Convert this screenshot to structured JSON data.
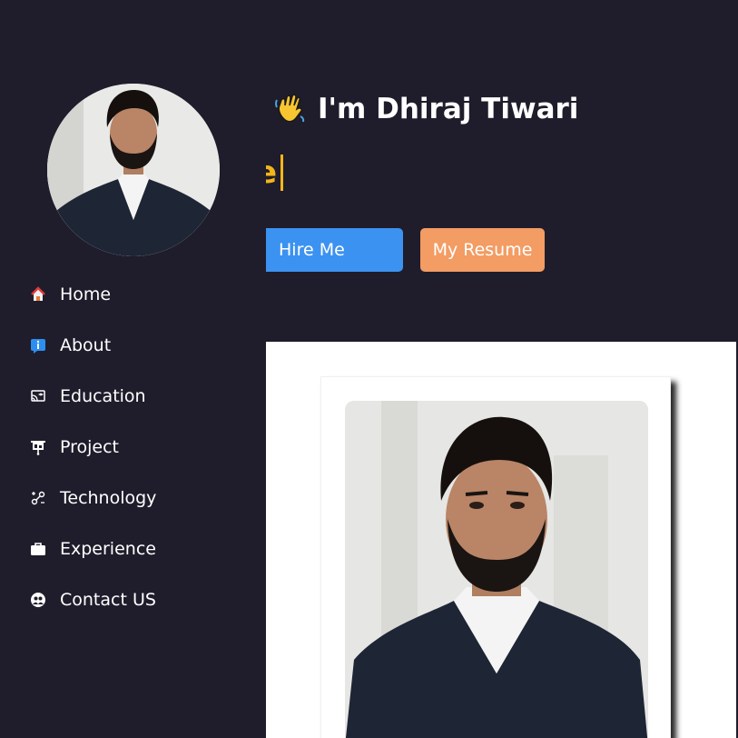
{
  "header": {
    "toggle_icon": "double-chevron-right-icon",
    "greeting": "I'm Dhiraj Tiwari",
    "wave_icon": "waving-hand-emoji",
    "typed_text": "e"
  },
  "buttons": {
    "hire_label": "Hire Me",
    "resume_label": "My Resume"
  },
  "sidebar": {
    "avatar_icon": "profile-photo",
    "items": [
      {
        "label": "Home",
        "icon": "house-icon"
      },
      {
        "label": "About",
        "icon": "info-icon"
      },
      {
        "label": "Education",
        "icon": "cast-education-icon"
      },
      {
        "label": "Project",
        "icon": "presentation-icon"
      },
      {
        "label": "Technology",
        "icon": "tech-icon"
      },
      {
        "label": "Experience",
        "icon": "briefcase-icon"
      },
      {
        "label": "Contact US",
        "icon": "contact-icon"
      }
    ]
  },
  "colors": {
    "background": "#1f1d2b",
    "typed_accent": "#f3b51c",
    "hire_button": "#3c92f0",
    "resume_button": "#f39c63"
  }
}
